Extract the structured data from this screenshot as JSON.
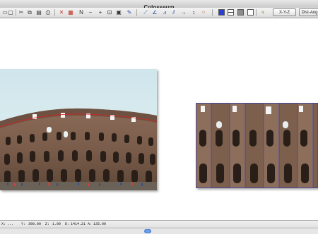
{
  "window": {
    "title": "Colosseum"
  },
  "toolbar": {
    "icons": [
      "new-document-icon",
      "open-icon",
      "save-icon",
      "cut-icon",
      "copy-icon",
      "paste-icon",
      "print-icon",
      "cross-mark-icon",
      "grid-select-icon",
      "north-arrow-icon",
      "minus-icon",
      "plus-icon",
      "tag-icon",
      "layers-icon",
      "brush-icon",
      "line-tool-icon",
      "angle-tool-icon",
      "polyline-icon",
      "dimension-icon",
      "arrow-right-icon",
      "vertical-arrow-icon",
      "point-grid-icon",
      "fill-blue",
      "view-split",
      "fill-gray",
      "frame-cross-icon",
      "pin-icon"
    ],
    "xyz_button": "X-Y-Z",
    "dist_button": "Dist-Ang",
    "colors": {
      "accent_blue": "#2a3fd4",
      "gray": "#8c8c8c"
    }
  },
  "status": {
    "x_label": "X:",
    "x_value": "...",
    "y_label": "Y:",
    "y_value": "300.00",
    "z_label": "Z:",
    "z_value": "1.00",
    "d_label": "D:",
    "d_value": "1414.21",
    "a_label": "A:",
    "a_value": "135.00"
  },
  "photos": {
    "left": {
      "subject": "colosseum-photo"
    },
    "right": {
      "subject": "colosseum-rectified-facade"
    }
  }
}
